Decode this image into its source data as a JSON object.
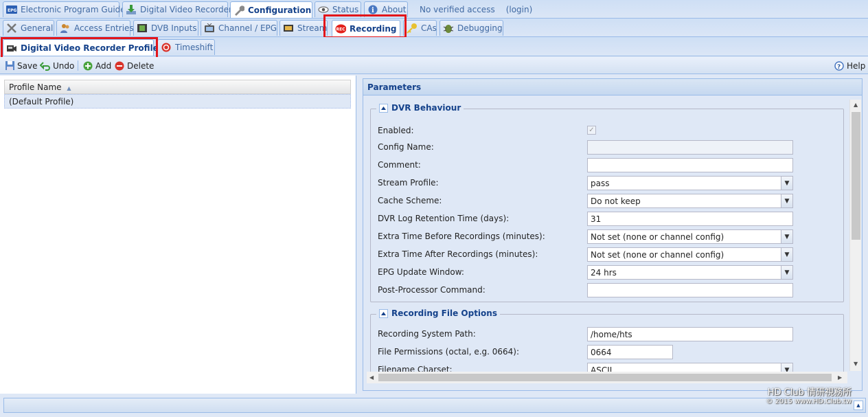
{
  "top_tabs": [
    {
      "label": "Electronic Program Guide",
      "icon": "epg-icon"
    },
    {
      "label": "Digital Video Recorder",
      "icon": "download-icon"
    },
    {
      "label": "Configuration",
      "icon": "wrench-icon"
    },
    {
      "label": "Status",
      "icon": "eye-icon"
    },
    {
      "label": "About",
      "icon": "info-icon"
    }
  ],
  "access": {
    "text": "No verified access",
    "login": "(login)"
  },
  "config_tabs": [
    {
      "label": "General",
      "icon": "tools-icon"
    },
    {
      "label": "Access Entries",
      "icon": "users-icon"
    },
    {
      "label": "DVB Inputs",
      "icon": "film-icon"
    },
    {
      "label": "Channel / EPG",
      "icon": "tv-icon"
    },
    {
      "label": "Stream",
      "icon": "stream-icon"
    },
    {
      "label": "Recording",
      "icon": "rec-icon"
    },
    {
      "label": "CAs",
      "icon": "key-icon"
    },
    {
      "label": "Debugging",
      "icon": "bug-icon"
    }
  ],
  "sub_tabs": [
    {
      "label": "Digital Video Recorder Profiles",
      "icon": "camera-icon"
    },
    {
      "label": "Timeshift",
      "icon": "timeshift-icon"
    }
  ],
  "toolbar": {
    "save": "Save",
    "undo": "Undo",
    "add": "Add",
    "delete": "Delete",
    "help": "Help"
  },
  "grid": {
    "column": "Profile Name",
    "rows": [
      "(Default Profile)"
    ]
  },
  "parameters": {
    "title": "Parameters",
    "dvr_behaviour": {
      "title": "DVR Behaviour",
      "enabled_label": "Enabled:",
      "enabled": true,
      "config_name_label": "Config Name:",
      "config_name": "",
      "comment_label": "Comment:",
      "comment": "",
      "stream_profile_label": "Stream Profile:",
      "stream_profile": "pass",
      "cache_scheme_label": "Cache Scheme:",
      "cache_scheme": "Do not keep",
      "log_retention_label": "DVR Log Retention Time (days):",
      "log_retention": "31",
      "extra_before_label": "Extra Time Before Recordings (minutes):",
      "extra_before": "Not set (none or channel config)",
      "extra_after_label": "Extra Time After Recordings (minutes):",
      "extra_after": "Not set (none or channel config)",
      "epg_window_label": "EPG Update Window:",
      "epg_window": "24 hrs",
      "post_processor_label": "Post-Processor Command:",
      "post_processor": ""
    },
    "file_options": {
      "title": "Recording File Options",
      "system_path_label": "Recording System Path:",
      "system_path": "/home/hts",
      "permissions_label": "File Permissions (octal, e.g. 0664):",
      "permissions": "0664",
      "charset_label": "Filename Charset:",
      "charset": "ASCII"
    }
  },
  "watermark": {
    "line1": "HD Club 情研視務所",
    "line2": "© 2015  www.HD.Club.tw"
  }
}
